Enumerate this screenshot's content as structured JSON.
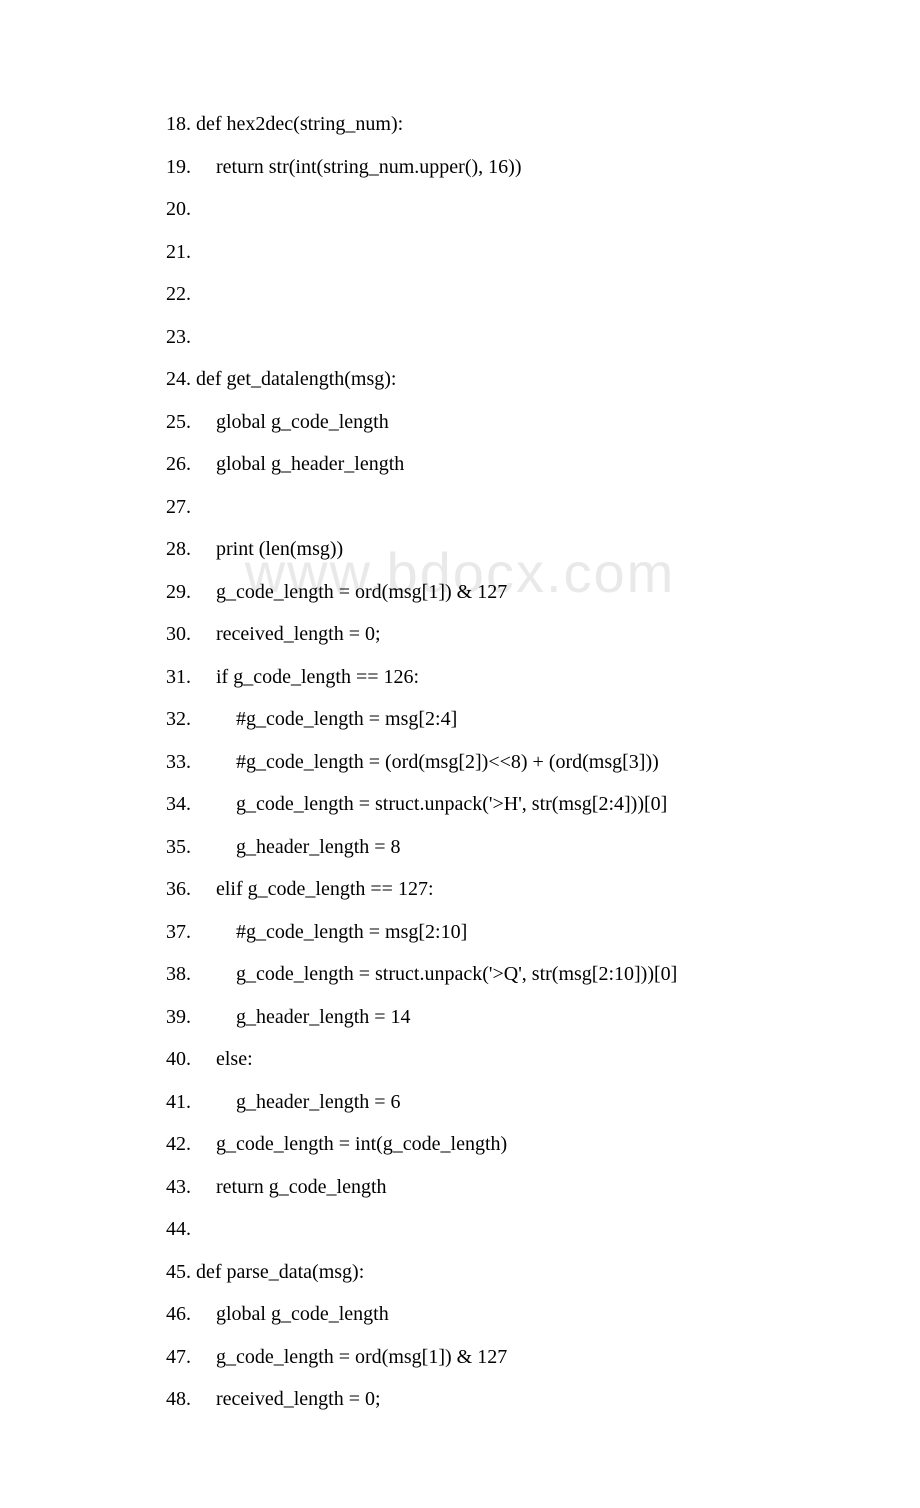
{
  "watermark": "www.bdocx.com",
  "lines": [
    {
      "num": "18.",
      "text": " def hex2dec(string_num):  "
    },
    {
      "num": "19.",
      "text": "     return str(int(string_num.upper(), 16))  "
    },
    {
      "num": "20.",
      "text": "   "
    },
    {
      "num": "21.",
      "text": "   "
    },
    {
      "num": "22.",
      "text": "   "
    },
    {
      "num": "23.",
      "text": "   "
    },
    {
      "num": "24.",
      "text": " def get_datalength(msg):  "
    },
    {
      "num": "25.",
      "text": "     global g_code_length  "
    },
    {
      "num": "26.",
      "text": "     global g_header_length    "
    },
    {
      "num": "27.",
      "text": "       "
    },
    {
      "num": "28.",
      "text": "     print (len(msg))  "
    },
    {
      "num": "29.",
      "text": "     g_code_length = ord(msg[1]) & 127  "
    },
    {
      "num": "30.",
      "text": "     received_length = 0;  "
    },
    {
      "num": "31.",
      "text": "     if g_code_length == 126:  "
    },
    {
      "num": "32.",
      "text": "         #g_code_length = msg[2:4]  "
    },
    {
      "num": "33.",
      "text": "         #g_code_length = (ord(msg[2])<<8) + (ord(msg[3]))  "
    },
    {
      "num": "34.",
      "text": "         g_code_length = struct.unpack('>H', str(msg[2:4]))[0]  "
    },
    {
      "num": "35.",
      "text": "         g_header_length = 8  "
    },
    {
      "num": "36.",
      "text": "     elif g_code_length == 127:  "
    },
    {
      "num": "37.",
      "text": "         #g_code_length = msg[2:10]  "
    },
    {
      "num": "38.",
      "text": "         g_code_length = struct.unpack('>Q', str(msg[2:10]))[0]  "
    },
    {
      "num": "39.",
      "text": "         g_header_length = 14  "
    },
    {
      "num": "40.",
      "text": "     else:  "
    },
    {
      "num": "41.",
      "text": "         g_header_length = 6  "
    },
    {
      "num": "42.",
      "text": "     g_code_length = int(g_code_length)  "
    },
    {
      "num": "43.",
      "text": "     return g_code_length  "
    },
    {
      "num": "44.",
      "text": "           "
    },
    {
      "num": "45.",
      "text": " def parse_data(msg):  "
    },
    {
      "num": "46.",
      "text": "     global g_code_length  "
    },
    {
      "num": "47.",
      "text": "     g_code_length = ord(msg[1]) & 127  "
    },
    {
      "num": "48.",
      "text": "     received_length = 0;  "
    }
  ]
}
